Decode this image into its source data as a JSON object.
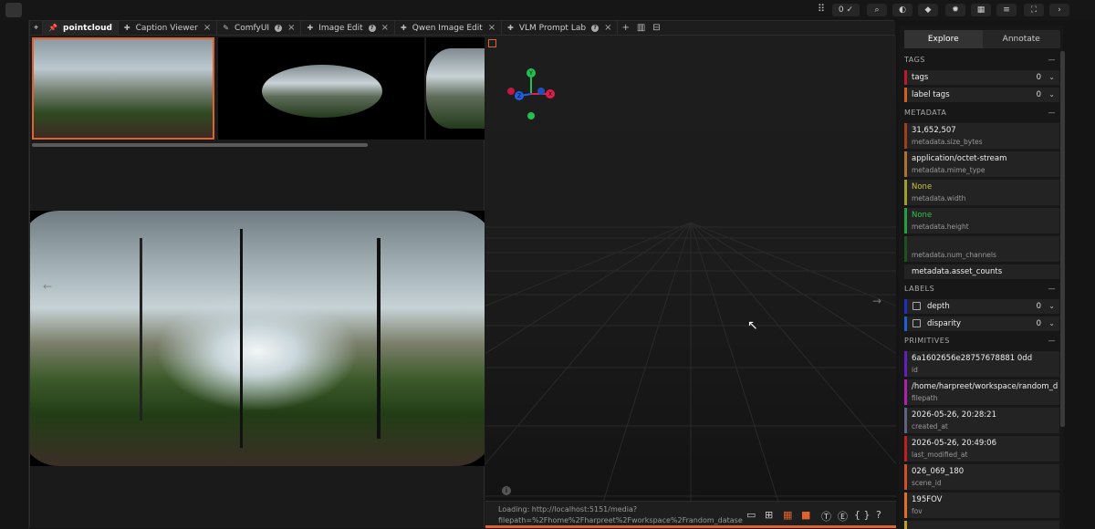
{
  "topbar": {
    "pill_value": "0",
    "pill_icon": "check-icon",
    "icons": [
      "search-icon",
      "palette-icon",
      "tag-icon",
      "gear-icon",
      "layout-icon",
      "list-icon",
      "fullscreen-icon",
      "chevron-right-icon"
    ]
  },
  "tabs": [
    {
      "label": "pointcloud",
      "icon": "pin-icon",
      "closable": false,
      "help": false
    },
    {
      "label": "Caption Viewer",
      "icon": "puzzle-icon",
      "closable": true,
      "help": false
    },
    {
      "label": "ComfyUI",
      "icon": "pen-icon",
      "closable": true,
      "help": true
    },
    {
      "label": "Image Edit",
      "icon": "puzzle-icon",
      "closable": true,
      "help": true
    },
    {
      "label": "Qwen Image Edit",
      "icon": "puzzle-icon",
      "closable": true,
      "help": false
    },
    {
      "label": "VLM Prompt Lab",
      "icon": "puzzle-icon",
      "closable": true,
      "help": true
    }
  ],
  "tab_actions": [
    "+",
    "▥",
    "⊟"
  ],
  "viewer3d": {
    "status_line1": "Loading: http://localhost:5151/media?",
    "status_line2": "filepath=%2Fhome%2Fharpreet%2Fworkspace%2Frandom_dataset_download",
    "axis_labels": {
      "y": "Y",
      "x": "X",
      "z": "Z"
    },
    "accent": "#e0622c"
  },
  "sidebar": {
    "tabs": [
      "Explore",
      "Annotate"
    ],
    "active_tab": "Explore",
    "sections": {
      "tags": "TAGS",
      "metadata": "METADATA",
      "labels": "LABELS",
      "primitives": "PRIMITIVES"
    },
    "tag_rows": [
      {
        "label": "tags",
        "count": "0",
        "color": "#c0192e"
      },
      {
        "label": "label tags",
        "count": "0",
        "color": "#d0601a"
      }
    ],
    "metadata_rows": [
      {
        "value": "31,652,507",
        "key": "metadata.size_bytes",
        "color": "#a0401a",
        "value_color": "#eeeeee"
      },
      {
        "value": "application/octet-stream",
        "key": "metadata.mime_type",
        "color": "#b07030",
        "value_color": "#eeeeee"
      },
      {
        "value": "None",
        "key": "metadata.width",
        "color": "#a0a020",
        "value_color": "#c8c830"
      },
      {
        "value": "None",
        "key": "metadata.height",
        "color": "#20a040",
        "value_color": "#30c050"
      },
      {
        "value": "",
        "key": "metadata.num_channels",
        "color": "#205020",
        "value_color": "#eeeeee"
      }
    ],
    "asset_counts": "metadata.asset_counts",
    "label_rows": [
      {
        "label": "depth",
        "count": "0",
        "color": "#2030c0"
      },
      {
        "label": "disparity",
        "count": "0",
        "color": "#2060d0"
      }
    ],
    "primitive_rows": [
      {
        "value": "6a1602656e28757678881 0dd",
        "key": "id",
        "color": "#6020c0"
      },
      {
        "value": "/home/harpreet/workspace/random_dat...",
        "key": "filepath",
        "color": "#b020b0"
      },
      {
        "value": "2026-05-26, 20:28:21",
        "key": "created_at",
        "color": "#606080"
      },
      {
        "value": "2026-05-26, 20:49:06",
        "key": "last_modified_at",
        "color": "#c02020"
      },
      {
        "value": "026_069_180",
        "key": "scene_id",
        "color": "#d05020"
      },
      {
        "value": "195FOV",
        "key": "fov",
        "color": "#e07020"
      },
      {
        "value": "",
        "key": "",
        "color": "#c0a020"
      }
    ]
  }
}
